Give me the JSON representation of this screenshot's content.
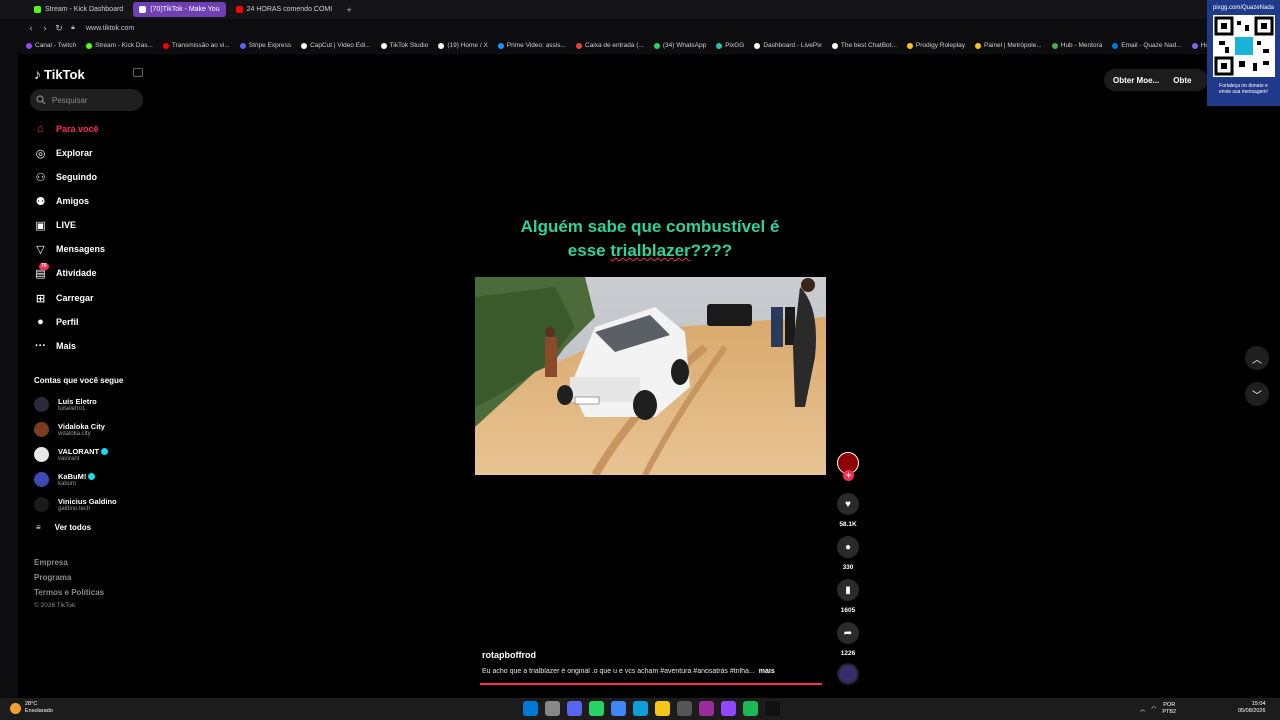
{
  "browser": {
    "tabs": [
      {
        "label": "Stream - Kick Dashboard",
        "color": "#53fc18",
        "active": false
      },
      {
        "label": "(70)TikTok - Make You",
        "color": "#ffffff",
        "active": true
      },
      {
        "label": "24 HORAS comendo COMI",
        "color": "#ff0000",
        "active": false
      }
    ],
    "url": "www.tiktok.com",
    "bookmarks": [
      {
        "label": "Canal - Twitch",
        "color": "#9146ff"
      },
      {
        "label": "Stream - Kick Das...",
        "color": "#53fc18"
      },
      {
        "label": "Transmissão ao vi...",
        "color": "#ff0000"
      },
      {
        "label": "Stripe Express",
        "color": "#635bff"
      },
      {
        "label": "CapCut | Video Edi...",
        "color": "#ffffff"
      },
      {
        "label": "TikTok Studio",
        "color": "#ffffff"
      },
      {
        "label": "(19) Home / X",
        "color": "#ffffff"
      },
      {
        "label": "Prime Video: assis...",
        "color": "#1399ff"
      },
      {
        "label": "Caixa de entrada (...",
        "color": "#ea4335"
      },
      {
        "label": "(34) WhatsApp",
        "color": "#25d366"
      },
      {
        "label": "PixGG",
        "color": "#32bcad"
      },
      {
        "label": "Dashboard - LivePix",
        "color": "#ffffff"
      },
      {
        "label": "The best ChatBot...",
        "color": "#ffffff"
      },
      {
        "label": "Prodigy Roleplay",
        "color": "#f5c518"
      },
      {
        "label": "Painel | Metrópole...",
        "color": "#f5c518"
      },
      {
        "label": "Hub - Mentora",
        "color": "#4caf50"
      },
      {
        "label": "Email - Quaze Nad...",
        "color": "#0078d4"
      },
      {
        "label": "Home -",
        "color": "#7b68ee"
      }
    ]
  },
  "sidebar": {
    "logo": "TikTok",
    "search_placeholder": "Pesquisar",
    "nav": [
      {
        "label": "Para você",
        "icon": "home-icon",
        "glyph": "⌂"
      },
      {
        "label": "Explorar",
        "icon": "compass-icon",
        "glyph": "◎"
      },
      {
        "label": "Seguindo",
        "icon": "user-follow-icon",
        "glyph": "⚇"
      },
      {
        "label": "Amigos",
        "icon": "friends-icon",
        "glyph": "⚉"
      },
      {
        "label": "LIVE",
        "icon": "live-icon",
        "glyph": "▣"
      },
      {
        "label": "Mensagens",
        "icon": "messages-icon",
        "glyph": "▽"
      },
      {
        "label": "Atividade",
        "icon": "activity-icon",
        "glyph": "▤",
        "badge": "70"
      },
      {
        "label": "Carregar",
        "icon": "upload-icon",
        "glyph": "⊞"
      },
      {
        "label": "Perfil",
        "icon": "profile-avatar-icon",
        "glyph": "●"
      },
      {
        "label": "Mais",
        "icon": "more-icon",
        "glyph": "···"
      }
    ],
    "following_title": "Contas que você segue",
    "accounts": [
      {
        "name": "Luís Eletro",
        "handle": "luiseletro1",
        "color": "#2a2a3a",
        "verified": false
      },
      {
        "name": "Vidaloka City",
        "handle": "vidaloka.city",
        "color": "#7a3b1e",
        "verified": false
      },
      {
        "name": "VALORANT",
        "handle": "valorant",
        "color": "#e8e8e8",
        "verified": true
      },
      {
        "name": "KaBuM!",
        "handle": "kabum",
        "color": "#3b4bb3",
        "verified": true
      },
      {
        "name": "Vinicius Galdino",
        "handle": "galdino.tech",
        "color": "#1b1b1b",
        "verified": false
      }
    ],
    "see_all": "Ver todos",
    "footer": [
      "Empresa",
      "Programa",
      "Termos e Políticas"
    ],
    "copyright": "© 2026 TikTok"
  },
  "topright": {
    "coins_label": "Obter Moe...",
    "second_label": "Obte",
    "qr_url": "pixgg.com/QuazeNada",
    "qr_caption_1": "Fortaleça no donate e",
    "qr_caption_2": "envie sua mensagem!"
  },
  "video": {
    "caption_line1": "Alguém sabe que combustível é",
    "caption_line2_a": "esse ",
    "caption_line2_b": "trialblazer",
    "caption_line2_c": "????",
    "author": "rotapboffrod",
    "description": "Eu acho que a trialblazer é original .o que u e vcs acham #aventura #anosatrás #trilha...",
    "more": "mais",
    "progress": 1.0,
    "likes": "58.1K",
    "comments": "330",
    "saves": "1605",
    "shares": "1226"
  },
  "taskbar": {
    "temp": "28°C",
    "weather": "Ensolarado",
    "lang1": "POR",
    "lang2": "PTB2",
    "time": "15:04",
    "date": "05/08/2026",
    "apps": [
      "#0078d4",
      "#888888",
      "#5865f2",
      "#25d366",
      "#4285f4",
      "#0c9fd8",
      "#f5c518",
      "#555555",
      "#9b2b9b",
      "#9146ff",
      "#1db954",
      "#111111"
    ]
  }
}
